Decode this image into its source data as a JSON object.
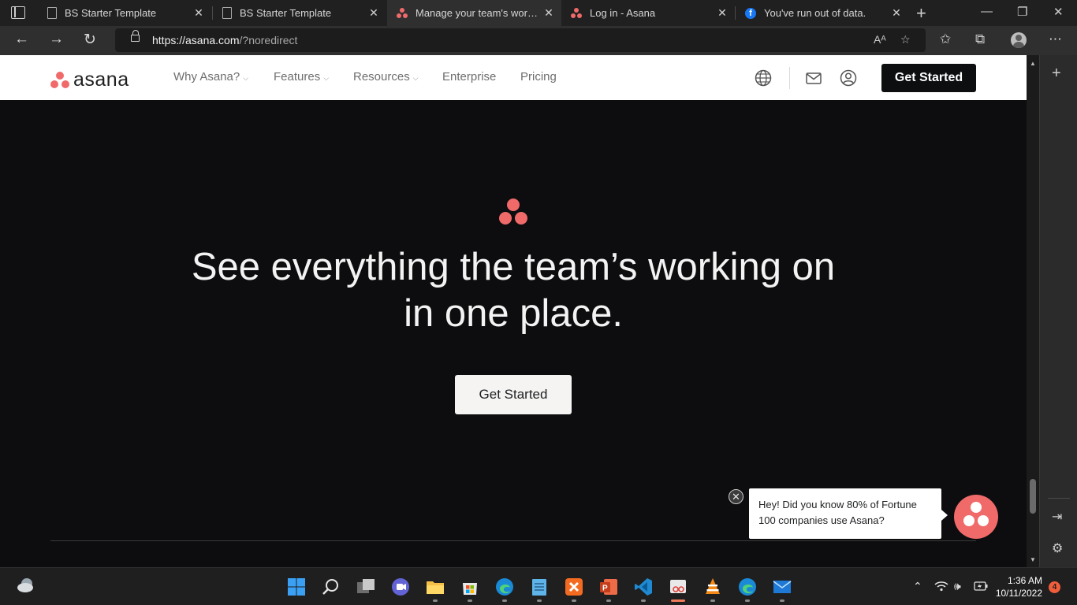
{
  "browser": {
    "tabs": [
      {
        "title": "BS Starter Template",
        "favicon": "document-icon",
        "active": false
      },
      {
        "title": "BS Starter Template",
        "favicon": "document-icon",
        "active": false
      },
      {
        "title": "Manage your team's work, pr",
        "favicon": "asana-icon",
        "active": true
      },
      {
        "title": "Log in - Asana",
        "favicon": "asana-icon",
        "active": false
      },
      {
        "title": "You've run out of data.",
        "favicon": "facebook-icon",
        "active": false
      }
    ],
    "url_host": "https://asana.com",
    "url_path": "/?noredirect"
  },
  "site": {
    "logo_text": "asana",
    "nav": [
      "Why Asana?",
      "Features",
      "Resources",
      "Enterprise",
      "Pricing"
    ],
    "cta_header": "Get Started",
    "brand_color": "#f06a6a"
  },
  "hero": {
    "title_line1": "See everything the team’s working on",
    "title_line2": "in one place.",
    "cta": "Get Started"
  },
  "chat": {
    "message": "Hey! Did you know 80% of Fortune 100 companies use Asana?"
  },
  "taskbar": {
    "time": "1:36 AM",
    "date": "10/11/2022",
    "notifications": "4"
  }
}
